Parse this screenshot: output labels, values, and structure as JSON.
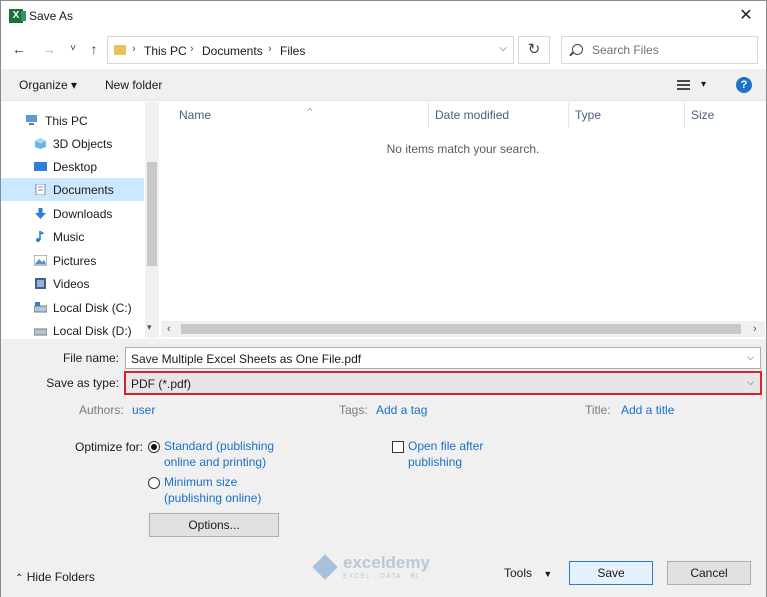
{
  "window": {
    "title": "Save As",
    "app_icon_letter": "X"
  },
  "nav": {
    "back": "←",
    "forward": "→",
    "recent": "˅",
    "up": "↑",
    "breadcrumbs": [
      "This PC",
      "Documents",
      "Files"
    ],
    "separator": "›",
    "refresh": "↻",
    "search_placeholder": "Search Files"
  },
  "toolbar": {
    "organize": "Organize ▾",
    "new_folder": "New folder",
    "help": "?",
    "view_caret": "▾"
  },
  "sidebar": {
    "items": [
      {
        "label": "This PC",
        "icon": "computer-icon",
        "root": true
      },
      {
        "label": "3D Objects",
        "icon": "cube-icon"
      },
      {
        "label": "Desktop",
        "icon": "desktop-icon"
      },
      {
        "label": "Documents",
        "icon": "documents-icon",
        "selected": true
      },
      {
        "label": "Downloads",
        "icon": "downloads-icon"
      },
      {
        "label": "Music",
        "icon": "music-icon"
      },
      {
        "label": "Pictures",
        "icon": "pictures-icon"
      },
      {
        "label": "Videos",
        "icon": "videos-icon"
      },
      {
        "label": "Local Disk (C:)",
        "icon": "disk-icon"
      },
      {
        "label": "Local Disk (D:)",
        "icon": "disk-icon"
      }
    ]
  },
  "filelist": {
    "columns": [
      "Name",
      "Date modified",
      "Type",
      "Size"
    ],
    "empty_message": "No items match your search."
  },
  "form": {
    "filename_label": "File name:",
    "filename_value": "Save Multiple Excel Sheets as One File.pdf",
    "type_label": "Save as type:",
    "type_value": "PDF (*.pdf)",
    "authors_label": "Authors:",
    "authors_value": "user",
    "tags_label": "Tags:",
    "tags_value": "Add a tag",
    "title_label": "Title:",
    "title_value": "Add a title",
    "optimize_label": "Optimize for:",
    "opt_standard_line1": "Standard (publishing",
    "opt_standard_line2": "online and printing)",
    "opt_minimum_line1": "Minimum size",
    "opt_minimum_line2": "(publishing online)",
    "open_after_line1": "Open file after",
    "open_after_line2": "publishing",
    "options_button": "Options...",
    "hide_folders": "Hide Folders",
    "tools": "Tools",
    "save": "Save",
    "cancel": "Cancel"
  },
  "watermark": {
    "text": "exceldemy",
    "subtext": "EXCEL · DATA · BI"
  },
  "colors": {
    "accent": "#1e72c6",
    "selected": "#cce8ff",
    "highlight_border": "#d8232a"
  }
}
